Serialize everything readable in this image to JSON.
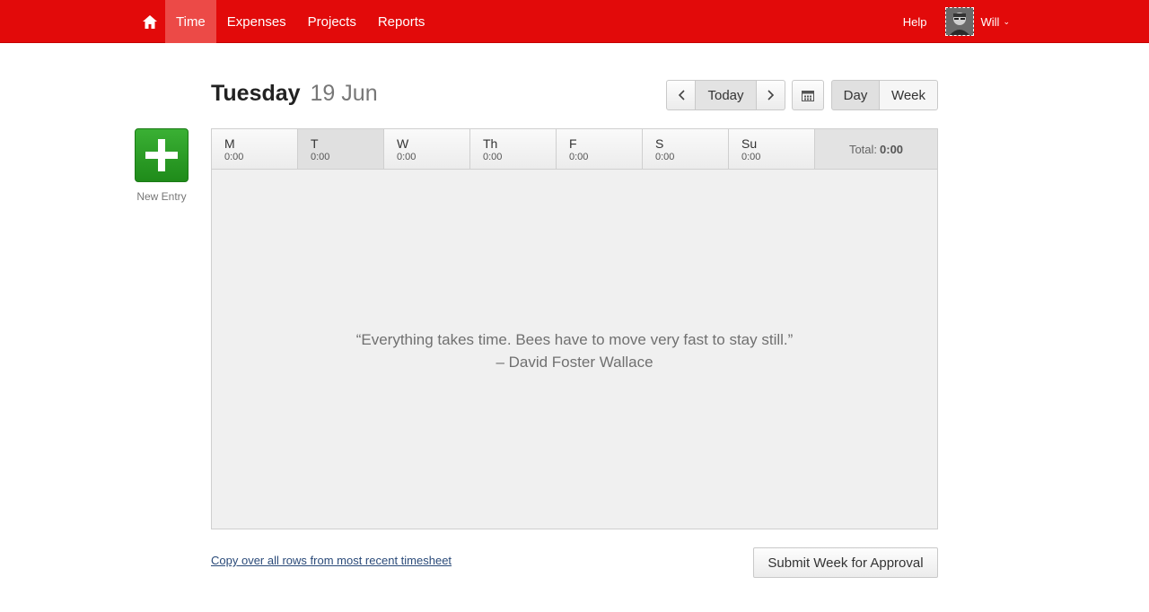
{
  "nav": {
    "items": [
      {
        "label": "Time"
      },
      {
        "label": "Expenses"
      },
      {
        "label": "Projects"
      },
      {
        "label": "Reports"
      }
    ],
    "help": "Help",
    "user": "Will",
    "colors": {
      "brand": "#e20a0a",
      "active": "#ec4a47"
    }
  },
  "header": {
    "weekday": "Tuesday",
    "date": "19 Jun",
    "today": "Today",
    "views": {
      "day": "Day",
      "week": "Week"
    }
  },
  "new_entry": {
    "label": "New Entry"
  },
  "week": {
    "days": [
      {
        "name": "M",
        "time": "0:00"
      },
      {
        "name": "T",
        "time": "0:00"
      },
      {
        "name": "W",
        "time": "0:00"
      },
      {
        "name": "Th",
        "time": "0:00"
      },
      {
        "name": "F",
        "time": "0:00"
      },
      {
        "name": "S",
        "time": "0:00"
      },
      {
        "name": "Su",
        "time": "0:00"
      }
    ],
    "total_label": "Total:",
    "total_value": "0:00"
  },
  "quote": {
    "text": "“Everything takes time. Bees have to move very fast to stay still.”",
    "author": "– David Foster Wallace"
  },
  "footer": {
    "copy_link": "Copy over all rows from most recent timesheet",
    "submit": "Submit Week for Approval"
  }
}
